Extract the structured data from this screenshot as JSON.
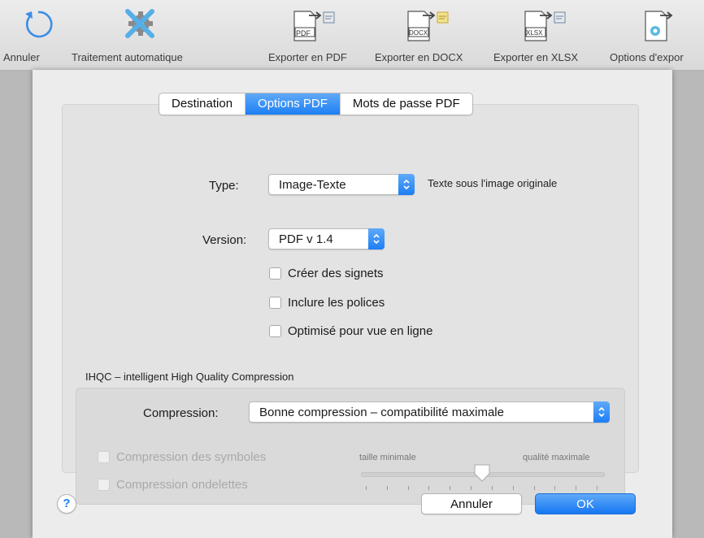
{
  "toolbar": {
    "undo_label": "Annuler",
    "auto_label": "Traitement automatique",
    "export_pdf_label": "Exporter en PDF",
    "export_docx_label": "Exporter en DOCX",
    "export_xlsx_label": "Exporter en XLSX",
    "export_options_label": "Options d'expor",
    "pdf_badge": "PDF",
    "docx_badge": "DOCX",
    "xlsx_badge": "XLSX"
  },
  "tabs": [
    {
      "label": "Destination",
      "active": false
    },
    {
      "label": "Options PDF",
      "active": true
    },
    {
      "label": "Mots de passe PDF",
      "active": false
    }
  ],
  "type": {
    "label": "Type:",
    "value": "Image-Texte",
    "note": "Texte sous l'image originale"
  },
  "version": {
    "label": "Version:",
    "value": "PDF v 1.4"
  },
  "options": [
    {
      "label": "Créer des signets",
      "checked": false
    },
    {
      "label": "Inclure les polices",
      "checked": false
    },
    {
      "label": "Optimisé pour vue en ligne",
      "checked": false
    }
  ],
  "ihqc": {
    "title": "IHQC – intelligent High Quality Compression",
    "compression_label": "Compression:",
    "compression_value": "Bonne compression – compatibilité maximale",
    "symbols_label": "Compression des symboles",
    "wavelet_label": "Compression ondelettes",
    "slider_min_label": "taille minimale",
    "slider_max_label": "qualité maximale",
    "slider_value_fraction": 0.5
  },
  "buttons": {
    "help": "?",
    "cancel": "Annuler",
    "ok": "OK"
  },
  "colors": {
    "accent": "#1d7ff4",
    "undo_icon": "#3a8de6",
    "auto_icon": "#56aee6",
    "gear": "#8a8a8a"
  }
}
